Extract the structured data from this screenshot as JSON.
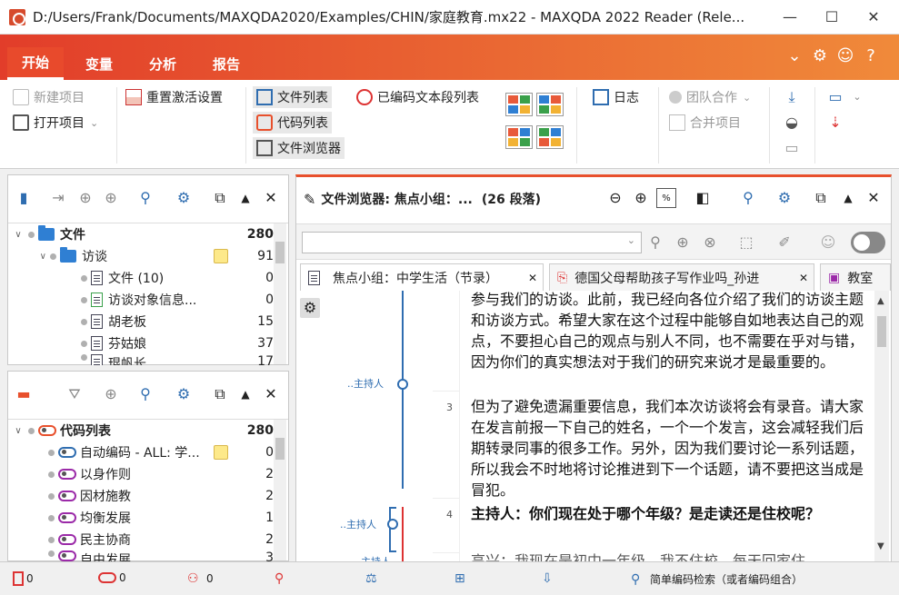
{
  "window": {
    "title": "D:/Users/Frank/Documents/MAXQDA2020/Examples/CHIN/家庭教育.mx22 - MAXQDA 2022 Reader (Rele...",
    "min": "—",
    "max": "☐",
    "close": "✕"
  },
  "menu": {
    "tabs": [
      "开始",
      "变量",
      "分析",
      "报告"
    ]
  },
  "ribbon": {
    "new_project": "新建项目",
    "open_project": "打开项目",
    "reset_activation": "重置激活设置",
    "doc_list": "文件列表",
    "code_list": "代码列表",
    "doc_browser": "文件浏览器",
    "coded_segments": "已编码文本段列表",
    "log": "日志",
    "teamwork": "团队合作",
    "merge_projects": "合并项目"
  },
  "doc_panel": {
    "rows": [
      {
        "label": "文件",
        "count": "280"
      },
      {
        "label": "访谈",
        "count": "91"
      },
      {
        "label": "文件 (10)",
        "count": "0"
      },
      {
        "label": "访谈对象信息...",
        "count": "0"
      },
      {
        "label": "胡老板",
        "count": "15"
      },
      {
        "label": "芬姑娘",
        "count": "37"
      },
      {
        "label": "琨帆长",
        "count": "17"
      }
    ]
  },
  "code_panel": {
    "rows": [
      {
        "label": "代码列表",
        "count": "280"
      },
      {
        "label": "自动编码 - ALL: 学...",
        "count": "0"
      },
      {
        "label": "以身作则",
        "count": "2"
      },
      {
        "label": "因材施教",
        "count": "2"
      },
      {
        "label": "均衡发展",
        "count": "1"
      },
      {
        "label": "民主协商",
        "count": "2"
      },
      {
        "label": "自由发展",
        "count": "3"
      }
    ]
  },
  "browser": {
    "title": "文件浏览器: 焦点小组：...",
    "segments": "(26 段落)",
    "tabs": [
      "焦点小组：中学生活（节录）",
      "德国父母帮助孩子写作业吗_孙进",
      "教室"
    ],
    "speaker1": "..主持人",
    "speaker2": "..主持人",
    "speaker3": "..主持人",
    "para_nums": [
      "3",
      "4"
    ],
    "para1": "参与我们的访谈。此前，我已经向各位介绍了我们的访谈主题和访谈方式。希望大家在这个过程中能够自如地表达自己的观点，不要担心自己的观点与别人不同，也不需要在乎对与错，因为你们的真实想法对于我们的研究来说才是最重要的。",
    "para2": "但为了避免遗漏重要信息，我们本次访谈将会有录音。请大家在发言前报一下自己的姓名，一个一个发言，这会减轻我们后期转录同事的很多工作。另外，因为我们要讨论一系列话题，所以我会不时地将讨论推进到下一个话题，请不要把这当成是冒犯。",
    "para3": "主持人：你们现在处于哪个年级？是走读还是住校呢？",
    "para4": "高兴：我现在是初中一年级，我不住校，每天回家住。"
  },
  "status": {
    "items": [
      "0",
      "0",
      "0"
    ],
    "search": "简单编码检索（或者编码组合）"
  },
  "colors": {
    "accent": "#e8502c",
    "folder": "#2f7fd3",
    "speaker_line": "#2f6db0",
    "red_line": "#d33"
  }
}
